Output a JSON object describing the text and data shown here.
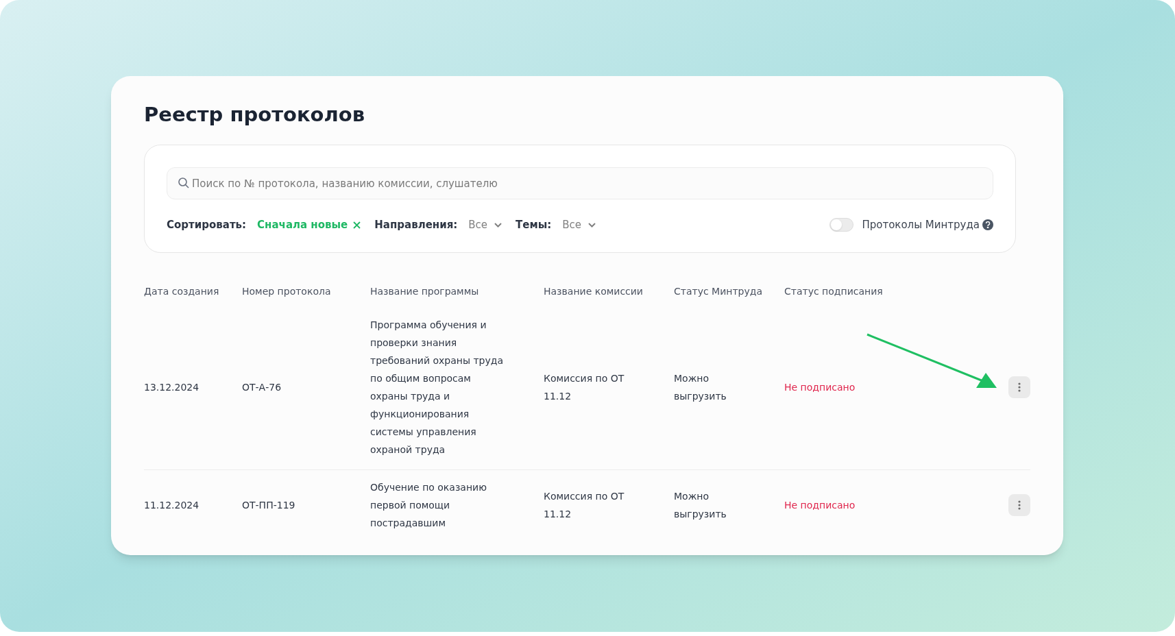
{
  "title": "Реестр протоколов",
  "search": {
    "placeholder": "Поиск по № протокола, названию комиссии, слушателю"
  },
  "filters": {
    "sort_label": "Сортировать:",
    "sort_value": "Сначала новые",
    "directions_label": "Направления:",
    "directions_value": "Все",
    "topics_label": "Темы:",
    "topics_value": "Все",
    "mintrud_toggle": {
      "label": "Протоколы Минтруда",
      "on": false
    }
  },
  "table": {
    "columns": [
      "Дата создания",
      "Номер протокола",
      "Название программы",
      "Название комиссии",
      "Статус Минтруда",
      "Статус подписания"
    ],
    "rows": [
      {
        "date": "13.12.2024",
        "number": "ОТ-А-76",
        "program": "Программа обучения и проверки знания требований охраны труда по общим вопросам охраны труда и функционирования системы управления охраной труда",
        "commission": "Комиссия по ОТ 11.12",
        "mintrud_status": "Можно выгрузить",
        "sign_status": "Не подписано",
        "signed": false
      },
      {
        "date": "11.12.2024",
        "number": "ОТ-ПП-119",
        "program": "Обучение по оказанию первой помощи пострадавшим",
        "commission": "Комиссия по ОТ 11.12",
        "mintrud_status": "Можно выгрузить",
        "sign_status": "Не подписано",
        "signed": false
      }
    ]
  }
}
